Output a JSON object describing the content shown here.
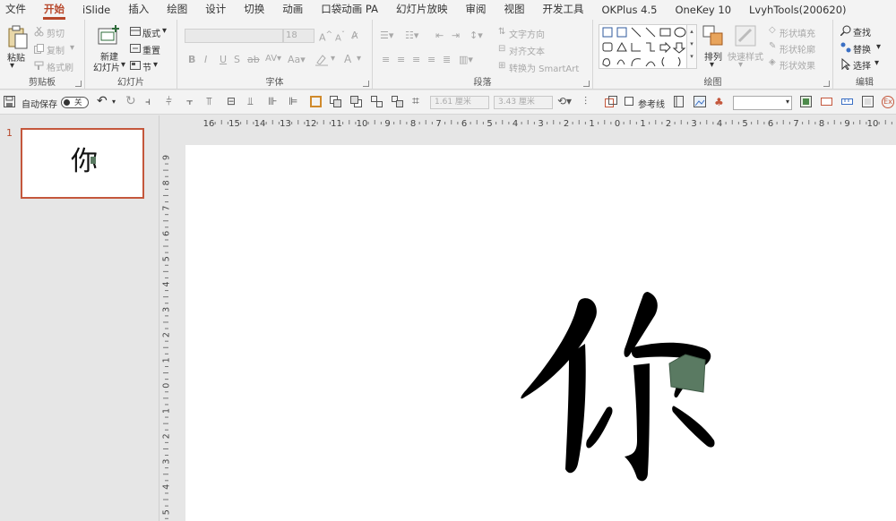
{
  "menu": {
    "tabs": [
      {
        "label": "文件",
        "active": false
      },
      {
        "label": "开始",
        "active": true
      },
      {
        "label": "iSlide",
        "active": false
      },
      {
        "label": "插入",
        "active": false
      },
      {
        "label": "绘图",
        "active": false
      },
      {
        "label": "设计",
        "active": false
      },
      {
        "label": "切换",
        "active": false
      },
      {
        "label": "动画",
        "active": false
      },
      {
        "label": "口袋动画 PA",
        "active": false
      },
      {
        "label": "幻灯片放映",
        "active": false
      },
      {
        "label": "审阅",
        "active": false
      },
      {
        "label": "视图",
        "active": false
      },
      {
        "label": "开发工具",
        "active": false
      },
      {
        "label": "OKPlus 4.5",
        "active": false
      },
      {
        "label": "OneKey 10",
        "active": false
      },
      {
        "label": "LvyhTools(200620)",
        "active": false
      }
    ]
  },
  "ribbon": {
    "clipboard": {
      "label": "剪贴板",
      "paste": "粘贴",
      "cut": "剪切",
      "copy": "复制",
      "format_painter": "格式刷"
    },
    "slides": {
      "label": "幻灯片",
      "new_slide_line1": "新建",
      "new_slide_line2": "幻灯片",
      "layout": "版式",
      "reset": "重置",
      "section": "节"
    },
    "font": {
      "label": "字体",
      "size": "18"
    },
    "paragraph": {
      "label": "段落",
      "text_direction": "文字方向",
      "align_text": "对齐文本",
      "smartart": "转换为 SmartArt"
    },
    "drawing": {
      "label": "绘图",
      "arrange": "排列",
      "quick_styles": "快速样式",
      "shape_fill": "形状填充",
      "shape_outline": "形状轮廓",
      "shape_effects": "形状效果"
    },
    "editing": {
      "label": "编辑",
      "find": "查找",
      "replace": "替换",
      "select": "选择"
    }
  },
  "qat": {
    "autosave_label": "自动保存",
    "autosave_state": "关",
    "height_value": "1.61 厘米",
    "width_value": "3.43 厘米",
    "guides_label": "参考线"
  },
  "slides_panel": {
    "slides": [
      {
        "number": "1",
        "text": "你"
      }
    ]
  },
  "rulers": {
    "horizontal": [
      "16",
      "15",
      "14",
      "13",
      "12",
      "11",
      "10",
      "9",
      "8",
      "7",
      "6",
      "5",
      "4",
      "3",
      "2",
      "1",
      "0",
      "1",
      "2",
      "3",
      "4",
      "5",
      "6",
      "7",
      "8",
      "9",
      "10"
    ],
    "vertical": [
      "9",
      "8",
      "7",
      "6",
      "5",
      "4",
      "3",
      "2",
      "1",
      "0",
      "1",
      "2",
      "3",
      "4",
      "5"
    ]
  },
  "colors": {
    "accent": "#b7472a",
    "shape_fill": "#5a7a62",
    "glyph": "#000000"
  }
}
